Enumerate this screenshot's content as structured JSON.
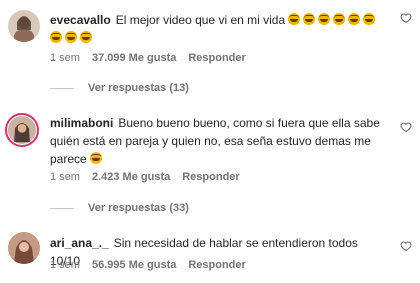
{
  "comments": [
    {
      "username": "evecavallo",
      "text": "El mejor video que vi en mi vida",
      "emoji_count": 9,
      "time": "1 sem",
      "likes": "37.099 Me gusta",
      "reply_label": "Responder",
      "view_replies": "Ver respuestas (13)"
    },
    {
      "username": "milimaboni",
      "text": "Bueno bueno bueno, como si fuera que ella sabe quién está en pareja y quien no, esa seña estuvo demas me parece",
      "time": "1 sem",
      "likes": "2.423 Me gusta",
      "reply_label": "Responder",
      "view_replies": "Ver respuestas (33)"
    },
    {
      "username": "ari_ana_._",
      "text": "Sin necesidad de hablar se entendieron todos 10/10",
      "time": "1 sem",
      "likes": "56.995 Me gusta",
      "reply_label": "Responder"
    }
  ],
  "colors": {
    "text": "#262626",
    "secondary": "#737373",
    "emoji": "#f5b400",
    "story_ring": "#e1306c"
  },
  "icons": [
    "heart-outline-icon",
    "laughing-emoji-icon"
  ]
}
